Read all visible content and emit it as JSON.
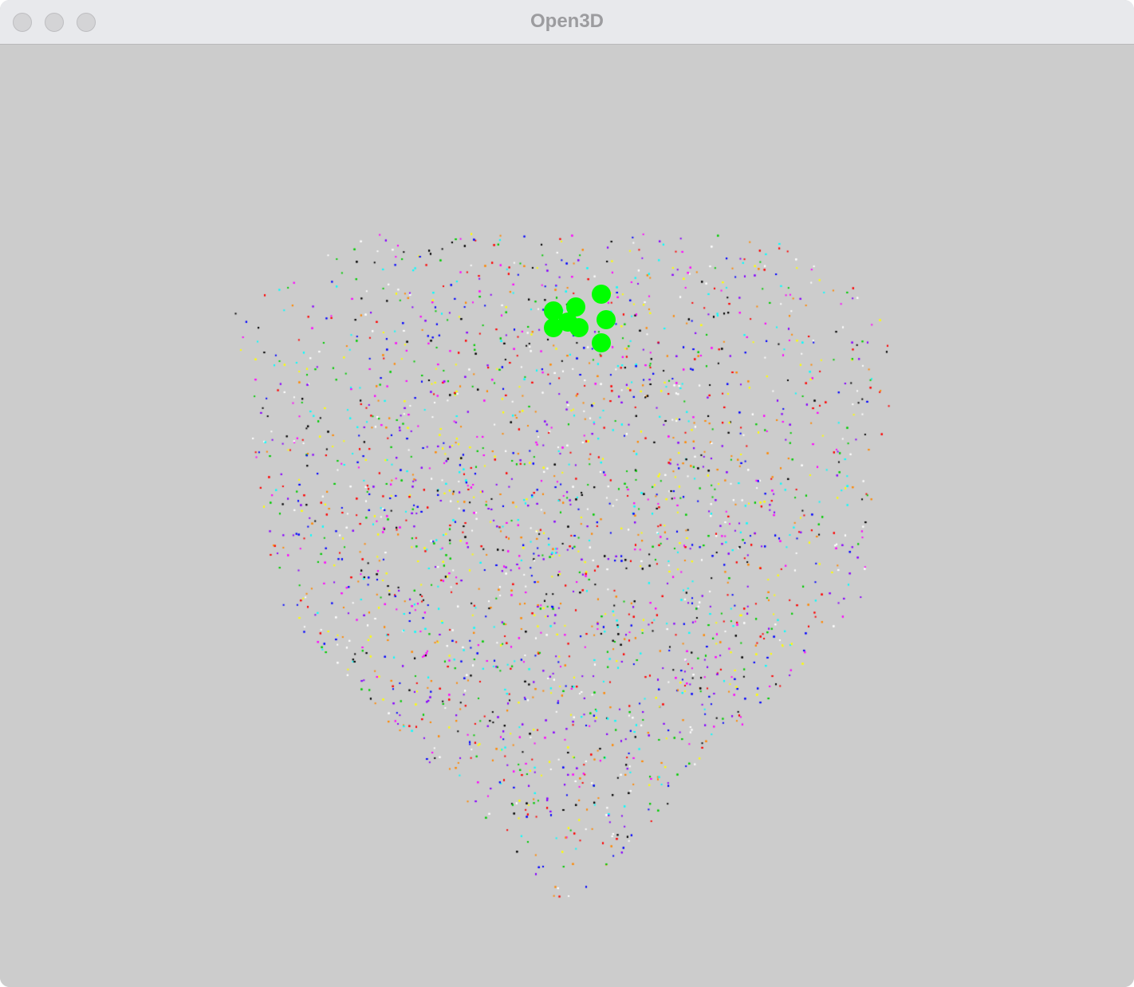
{
  "window": {
    "title": "Open3D",
    "buttons": [
      "close",
      "minimize",
      "zoom"
    ]
  },
  "viewer": {
    "background_color": "#cccccc",
    "point_cloud": {
      "description_shape": "inverted-shield",
      "point_colors": [
        "#ff0000",
        "#00cc00",
        "#0000ff",
        "#ff00ff",
        "#00ffff",
        "#ffff00",
        "#000000",
        "#ffffff",
        "#8800ff",
        "#ff8800"
      ]
    },
    "picked_points": {
      "color": "#00ff00",
      "count": 8
    }
  }
}
